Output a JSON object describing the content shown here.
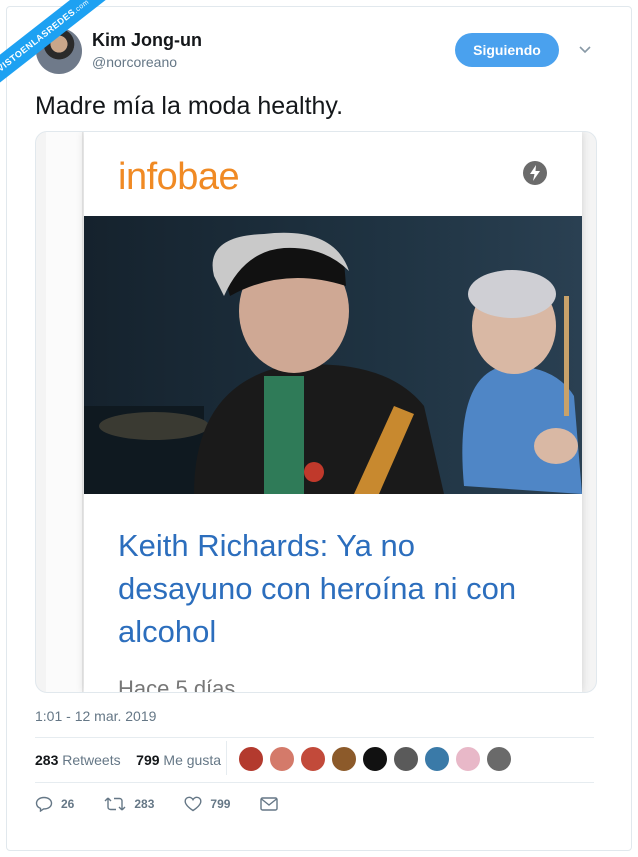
{
  "watermark": {
    "text": "VISTOENLASREDES",
    "suffix": ".com"
  },
  "author": {
    "name": "Kim Jong-un",
    "handle": "@norcoreano"
  },
  "follow_button": "Siguiendo",
  "tweet": {
    "text": "Madre mía la moda healthy."
  },
  "card": {
    "brand": "infobae",
    "headline": "Keith Richards: Ya no desayuno con heroína ni con alcohol",
    "time_ago": "Hace 5 días"
  },
  "timestamp": "1:01 - 12 mar. 2019",
  "stats": {
    "retweets_count": "283",
    "retweets_label": "Retweets",
    "likes_count": "799",
    "likes_label": "Me gusta"
  },
  "actions": {
    "replies": "26",
    "retweets": "283",
    "likes": "799"
  },
  "colors": {
    "accent": "#1da1f2",
    "brand": "#f08a24",
    "headline": "#2c6ebd"
  }
}
